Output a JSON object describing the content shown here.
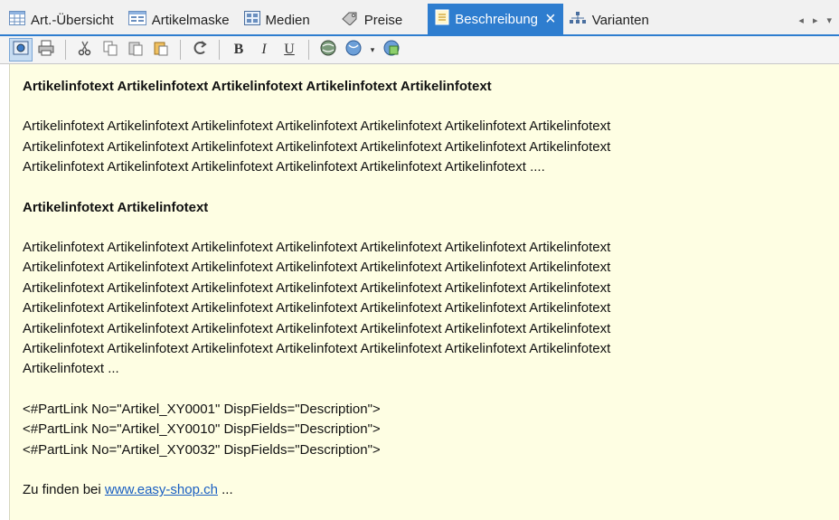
{
  "tabs": [
    {
      "label": "Art.-Übersicht",
      "icon": "grid-icon",
      "active": false
    },
    {
      "label": "Artikelmaske",
      "icon": "form-icon",
      "active": false
    },
    {
      "label": "Medien",
      "icon": "media-icon",
      "active": false
    },
    {
      "label": "Preise",
      "icon": "price-tag-icon",
      "active": false
    },
    {
      "label": "Beschreibung",
      "icon": "document-icon",
      "active": true
    },
    {
      "label": "Varianten",
      "icon": "variants-icon",
      "active": false
    }
  ],
  "tab_nav": {
    "prev": "◂",
    "next": "▸",
    "menu": "▾"
  },
  "toolbar": {
    "bold": "B",
    "italic": "I",
    "underline": "U",
    "dropdown_arrow": "▾"
  },
  "content": {
    "heading1": "Artikelinfotext Artikelinfotext Artikelinfotext Artikelinfotext Artikelinfotext",
    "para1": [
      "Artikelinfotext Artikelinfotext Artikelinfotext Artikelinfotext Artikelinfotext Artikelinfotext Artikelinfotext",
      "Artikelinfotext Artikelinfotext Artikelinfotext Artikelinfotext Artikelinfotext Artikelinfotext Artikelinfotext",
      "Artikelinfotext Artikelinfotext Artikelinfotext Artikelinfotext Artikelinfotext Artikelinfotext ...."
    ],
    "heading2": "Artikelinfotext Artikelinfotext",
    "para2": [
      "Artikelinfotext Artikelinfotext Artikelinfotext Artikelinfotext Artikelinfotext Artikelinfotext Artikelinfotext",
      "Artikelinfotext Artikelinfotext Artikelinfotext Artikelinfotext Artikelinfotext Artikelinfotext Artikelinfotext",
      "Artikelinfotext Artikelinfotext Artikelinfotext Artikelinfotext Artikelinfotext Artikelinfotext Artikelinfotext",
      "Artikelinfotext Artikelinfotext Artikelinfotext Artikelinfotext Artikelinfotext Artikelinfotext Artikelinfotext",
      "Artikelinfotext Artikelinfotext Artikelinfotext Artikelinfotext Artikelinfotext Artikelinfotext Artikelinfotext",
      "Artikelinfotext Artikelinfotext Artikelinfotext Artikelinfotext Artikelinfotext Artikelinfotext Artikelinfotext",
      "Artikelinfotext ..."
    ],
    "partlinks": [
      "<#PartLink No=\"Artikel_XY0001\" DispFields=\"Description\">",
      "<#PartLink No=\"Artikel_XY0010\" DispFields=\"Description\">",
      "<#PartLink No=\"Artikel_XY0032\" DispFields=\"Description\">"
    ],
    "footer_prefix": "Zu finden bei ",
    "footer_link": "www.easy-shop.ch",
    "footer_suffix": " ..."
  },
  "colors": {
    "accent": "#2e7dcf",
    "editor_background": "#fefee3",
    "link": "#1a5fc2"
  }
}
